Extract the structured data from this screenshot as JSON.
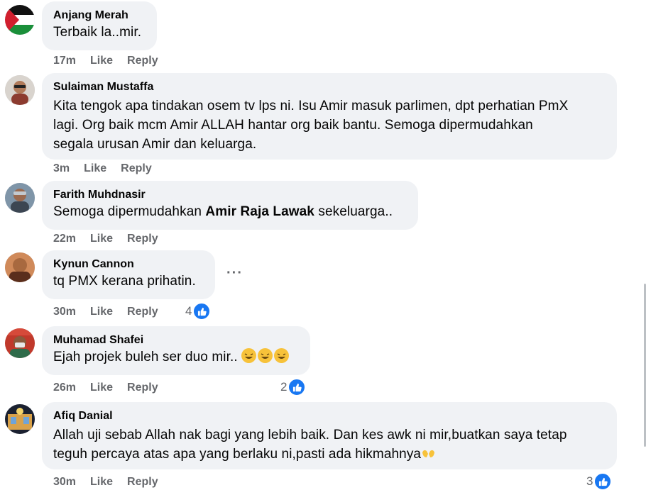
{
  "actions": {
    "like": "Like",
    "reply": "Reply"
  },
  "comments": [
    {
      "author": "Anjang Merah",
      "text": "Terbaik la..mir.",
      "time": "17m",
      "reactions": ""
    },
    {
      "author": "Sulaiman Mustaffa",
      "lines": [
        "Kita tengok apa tindakan osem tv lps ni. Isu Amir masuk parlimen, dpt perhatian PmX",
        "lagi. Org baik mcm Amir ALLAH hantar org baik bantu. Semoga dipermudahkan",
        "segala urusan Amir dan keluarga."
      ],
      "time": "3m",
      "reactions": ""
    },
    {
      "author": "Farith Muhdnasir",
      "text_before": "Semoga dipermudahkan ",
      "text_bold": "Amir Raja Lawak",
      "text_after": " sekeluarga..",
      "time": "22m",
      "reactions": ""
    },
    {
      "author": "Kynun Cannon",
      "text": "tq PMX kerana prihatin.",
      "time": "30m",
      "reactions": "4",
      "more": "···"
    },
    {
      "author": "Muhamad Shafei",
      "text": "Ejah projek buleh ser duo mir..",
      "time": "26m",
      "reactions": "2",
      "emoji": "laughing-face"
    },
    {
      "author": "Afiq Danial",
      "lines": [
        "Allah uji sebab Allah nak bagi yang lebih baik. Dan kes awk ni mir,buatkan saya tetap",
        "teguh percaya atas apa yang berlaku ni,pasti ada hikmahnya"
      ],
      "time": "30m",
      "reactions": "3",
      "emoji": "open-hands"
    }
  ],
  "colors": {
    "bubble": "#f0f2f5",
    "meta": "#65676b",
    "like_blue": "#1877f2"
  }
}
